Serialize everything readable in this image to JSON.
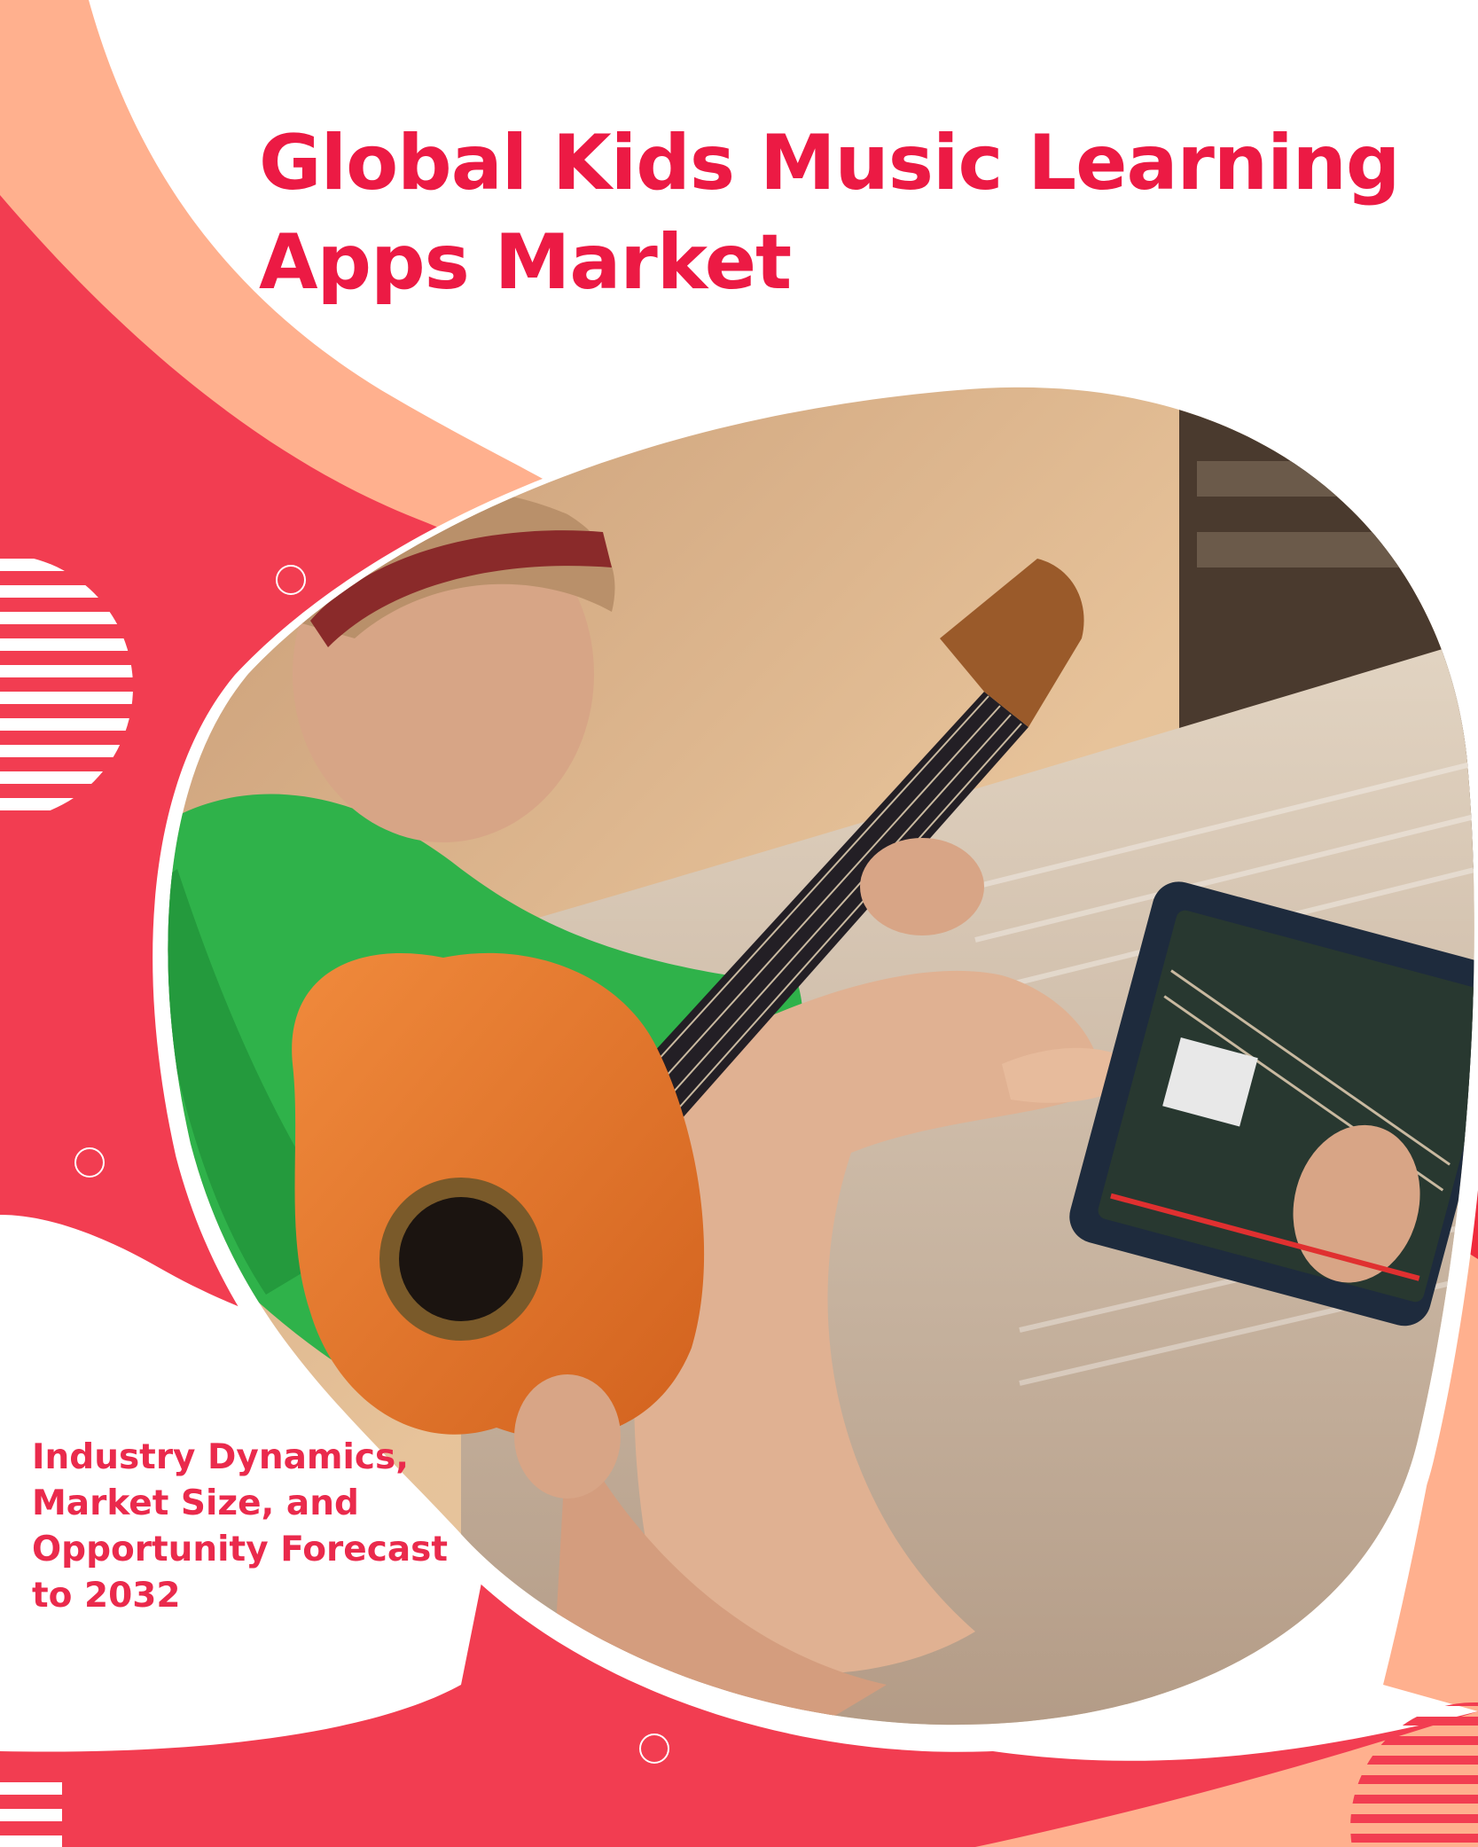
{
  "cover": {
    "title_lines": [
      "Global Kids Music Learning",
      "Apps Market"
    ],
    "subtitle_lines": [
      "Industry Dynamics,",
      "Market Size, and",
      "Opportunity Forecast",
      "to 2032"
    ]
  },
  "colors": {
    "accent_red": "#ec1a44",
    "coral_blob": "#f23d51",
    "peach_band": "#ffb08e",
    "background": "#ffffff"
  }
}
